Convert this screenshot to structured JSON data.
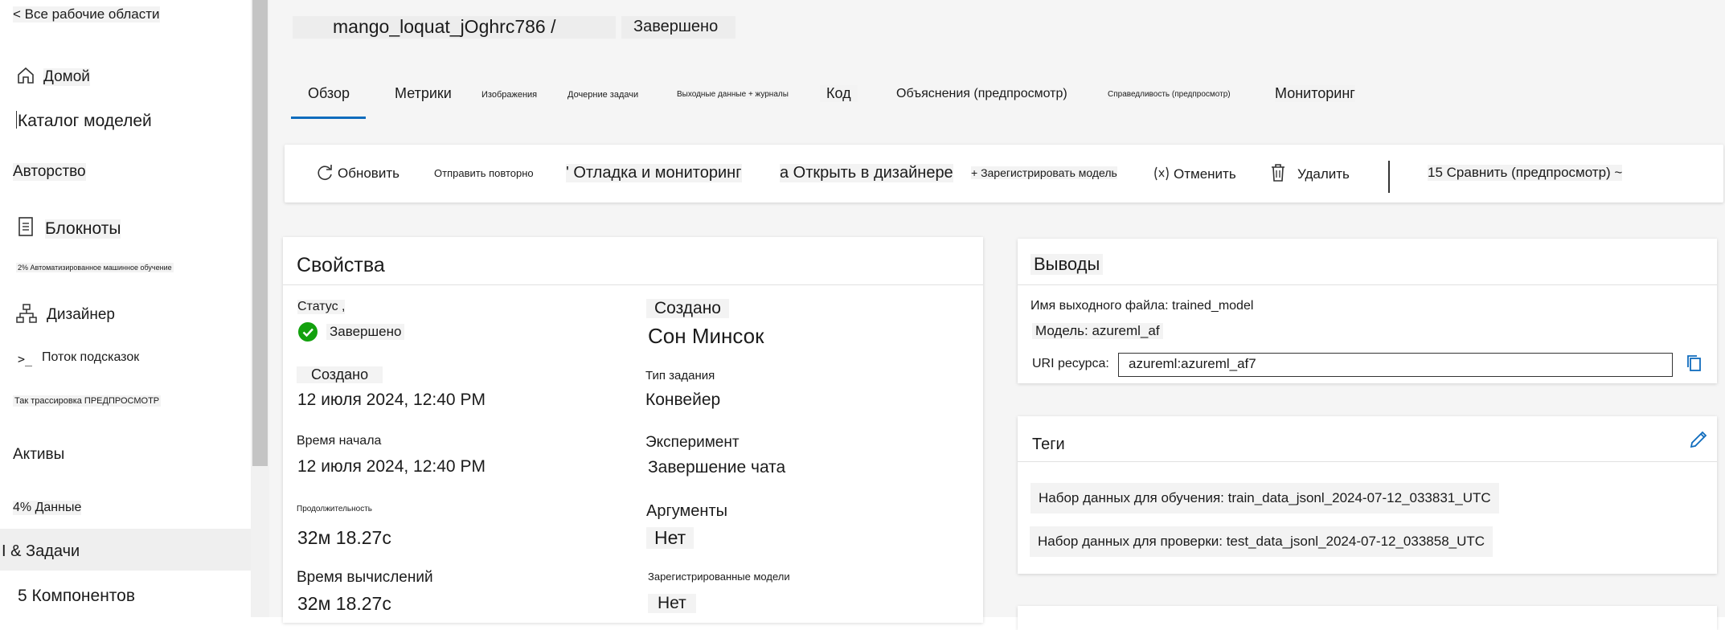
{
  "sidebar": {
    "back_link": "< Все рабочие области",
    "items": [
      {
        "label": "Домой",
        "icon": "home-icon"
      },
      {
        "label": "Каталог моделей"
      },
      {
        "label": "Авторство"
      },
      {
        "label": "Блокноты",
        "icon": "notebook-icon"
      },
      {
        "label": "2% Автоматизированное машинное обучение"
      },
      {
        "label": "Дизайнер",
        "icon": "designer-icon"
      },
      {
        "label": "Поток подсказок",
        "icon": "prompt-flow-icon"
      },
      {
        "label": "Так трассировка ПРЕДПРОСМОТР"
      },
      {
        "label": "Активы"
      },
      {
        "label": "4% Данные"
      },
      {
        "label": "I & Задачи"
      },
      {
        "label": "5 Компонентов"
      }
    ]
  },
  "header": {
    "title": "mango_loquat_jOghrc786 /",
    "status": "Завершено"
  },
  "tabs": [
    {
      "label": "Обзор",
      "active": true
    },
    {
      "label": "Метрики"
    },
    {
      "label": "Изображения"
    },
    {
      "label": "Дочерние задачи"
    },
    {
      "label": "Выходные данные + журналы"
    },
    {
      "label": "Код"
    },
    {
      "label": "Объяснения (предпросмотр)"
    },
    {
      "label": "Справедливость (предпросмотр)"
    },
    {
      "label": "Мониторинг"
    }
  ],
  "toolbar": {
    "refresh": "Обновить",
    "resubmit": "Отправить повторно",
    "debug": "' Отладка и мониторинг",
    "open_designer": "а Открыть в дизайнере",
    "register_model": "+ Зарегистрировать модель",
    "cancel": "Отменить",
    "delete": "Удалить",
    "compare": "15 Сравнить (предпросмотр) ~"
  },
  "properties": {
    "title": "Свойства",
    "status_label": "Статус ,",
    "status_value": "Завершено",
    "created_by_label": "Создано",
    "created_by_value": "Сон Минсок",
    "created_label": "Создано",
    "created_value": "12 июля 2024, 12:40 PM",
    "job_type_label": "Тип задания",
    "job_type_value": "Конвейер",
    "start_time_label": "Время начала",
    "start_time_value": "12 июля 2024, 12:40 PM",
    "experiment_label": "Эксперимент",
    "experiment_value": "Завершение чата",
    "duration_label": "Продолжительность",
    "duration_value": "32м 18.27с",
    "arguments_label": "Аргументы",
    "arguments_value": "Нет",
    "compute_time_label": "Время вычислений",
    "compute_time_value": "32м 18.27с",
    "registered_models_label": "Зарегистрированные модели",
    "registered_models_value": "Нет"
  },
  "outputs": {
    "title": "Выводы",
    "file_name": "Имя выходного файла: trained_model",
    "model": "Модель: azureml_af",
    "uri_label": "URI ресурса:",
    "uri_value": "azureml:azureml_af7"
  },
  "tags": {
    "title": "Теги",
    "items": [
      "Набор данных для обучения: train_data_jsonl_2024-07-12_033831_UTC",
      "Набор данных для проверки: test_data_jsonl_2024-07-12_033858_UTC"
    ]
  },
  "colors": {
    "accent": "#0f6cbd",
    "success": "#13a10e"
  }
}
